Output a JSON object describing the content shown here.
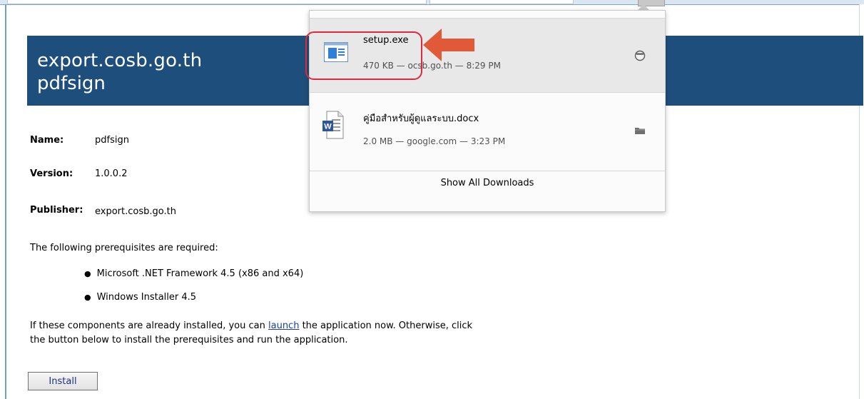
{
  "header": {
    "line1": "export.cosb.go.th",
    "line2": "pdfsign"
  },
  "details": {
    "name_label": "Name:",
    "name_value": "pdfsign",
    "version_label": "Version:",
    "version_value": "1.0.0.2",
    "publisher_label": "Publisher:",
    "publisher_value": "export.cosb.go.th"
  },
  "prereq": {
    "intro": "The following prerequisites are required:",
    "items": [
      "Microsoft .NET Framework 4.5 (x86 and x64)",
      "Windows Installer 4.5"
    ]
  },
  "instructions": {
    "line1_before": "If these components are already installed, you can ",
    "link": "launch",
    "line1_after": " the application now. Otherwise, click",
    "line2": "the button below to install the prerequisites and run the application."
  },
  "install_label": "Install",
  "downloads": {
    "items": [
      {
        "name": "setup.exe",
        "meta": "470 KB — ocsb.go.th — 8:29 PM",
        "icon": "exe-file-icon",
        "action_icon": "open-icon"
      },
      {
        "name": "คู่มือสำหรับผู้ดูแลระบบ.docx",
        "meta": "2.0 MB — google.com — 3:23 PM",
        "icon": "word-file-icon",
        "action_icon": "folder-icon"
      }
    ],
    "show_all": "Show All Downloads"
  },
  "colors": {
    "header_bg": "#1e4f7c",
    "highlight": "#e0283a",
    "annotation_arrow": "#e05a3a",
    "link": "#1a3ea8"
  }
}
